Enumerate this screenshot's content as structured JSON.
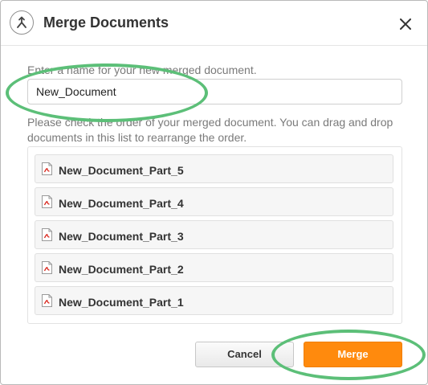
{
  "dialog": {
    "title": "Merge Documents",
    "icons": {
      "header": "merge-icon",
      "close": "close-icon",
      "document": "pdf-file-icon"
    }
  },
  "name_field": {
    "label": "Enter a name for your new merged document.",
    "value": "New_Document"
  },
  "order_instructions": "Please check the order of your merged document. You can drag and drop documents in this list to rearrange the order.",
  "documents": [
    {
      "name": "New_Document_Part_5"
    },
    {
      "name": "New_Document_Part_4"
    },
    {
      "name": "New_Document_Part_3"
    },
    {
      "name": "New_Document_Part_2"
    },
    {
      "name": "New_Document_Part_1"
    }
  ],
  "buttons": {
    "cancel_label": "Cancel",
    "merge_label": "Merge"
  },
  "colors": {
    "merge_button": "#ff8a0d",
    "annotation": "#5cbf78",
    "pdf_icon": "#d9261c"
  }
}
